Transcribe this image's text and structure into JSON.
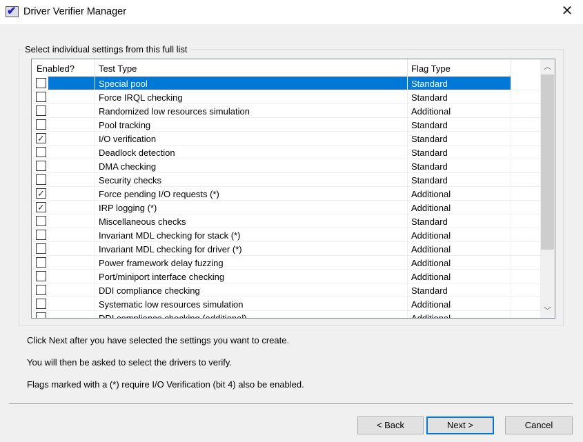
{
  "window": {
    "title": "Driver Verifier Manager"
  },
  "group": {
    "label": "Select individual settings from this full list"
  },
  "table": {
    "headers": [
      "Enabled?",
      "Test Type",
      "Flag Type"
    ],
    "rows": [
      {
        "checked": false,
        "test": "Special pool",
        "flag": "Standard",
        "selected": true
      },
      {
        "checked": false,
        "test": "Force IRQL checking",
        "flag": "Standard"
      },
      {
        "checked": false,
        "test": "Randomized low resources simulation",
        "flag": "Additional"
      },
      {
        "checked": false,
        "test": "Pool tracking",
        "flag": "Standard"
      },
      {
        "checked": true,
        "test": "I/O verification",
        "flag": "Standard"
      },
      {
        "checked": false,
        "test": "Deadlock detection",
        "flag": "Standard"
      },
      {
        "checked": false,
        "test": "DMA checking",
        "flag": "Standard"
      },
      {
        "checked": false,
        "test": "Security checks",
        "flag": "Standard"
      },
      {
        "checked": true,
        "test": "Force pending I/O requests (*)",
        "flag": "Additional"
      },
      {
        "checked": true,
        "test": "IRP logging (*)",
        "flag": "Additional"
      },
      {
        "checked": false,
        "test": "Miscellaneous checks",
        "flag": "Standard"
      },
      {
        "checked": false,
        "test": "Invariant MDL checking for stack (*)",
        "flag": "Additional"
      },
      {
        "checked": false,
        "test": "Invariant MDL checking for driver (*)",
        "flag": "Additional"
      },
      {
        "checked": false,
        "test": "Power framework delay fuzzing",
        "flag": "Additional"
      },
      {
        "checked": false,
        "test": "Port/miniport interface checking",
        "flag": "Additional"
      },
      {
        "checked": false,
        "test": "DDI compliance checking",
        "flag": "Standard"
      },
      {
        "checked": false,
        "test": "Systematic low resources simulation",
        "flag": "Additional"
      },
      {
        "checked": false,
        "test": "DDI compliance checking (additional)",
        "flag": "Additional"
      }
    ]
  },
  "notes": [
    "Click Next after you have selected the settings you want to create.",
    "You will then be asked to select the drivers to verify.",
    "Flags marked with a (*) require I/O Verification (bit 4) also be enabled."
  ],
  "buttons": {
    "back": "< Back",
    "next": "Next >",
    "cancel": "Cancel"
  },
  "colors": {
    "selection": "#0078d7"
  }
}
